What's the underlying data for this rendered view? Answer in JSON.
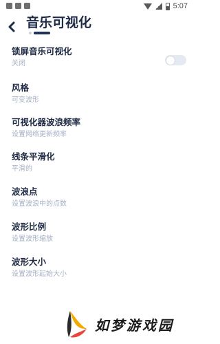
{
  "status_bar": {
    "time": "5:07",
    "icons": [
      "notification-icon",
      "notification-icon",
      "notification-icon",
      "wifi-icon",
      "signal-icon",
      "battery-icon"
    ]
  },
  "header": {
    "back_icon": "back-arrow-icon",
    "title": "音乐可视化"
  },
  "settings": [
    {
      "title": "锁屏音乐可视化",
      "subtitle": "关闭",
      "control": "toggle",
      "toggle_on": false
    },
    {
      "title": "风格",
      "subtitle": "可变波形"
    },
    {
      "title": "可视化器波浪频率",
      "subtitle": "设置网络更新频率"
    },
    {
      "title": "线条平滑化",
      "subtitle": "平滑的"
    },
    {
      "title": "波浪点",
      "subtitle": "设置波浪中的点数"
    },
    {
      "title": "波形比例",
      "subtitle": "设置波形缩放"
    },
    {
      "title": "波形大小",
      "subtitle": "设置波形起始大小"
    }
  ],
  "watermark": {
    "text": "如梦游戏园",
    "logo": "watermark-logo-icon"
  },
  "colors": {
    "title": "#1e2b47",
    "subtitle": "#a6b0c4",
    "indicator": "#20325a",
    "toggle_track": "#e5e9f1"
  }
}
